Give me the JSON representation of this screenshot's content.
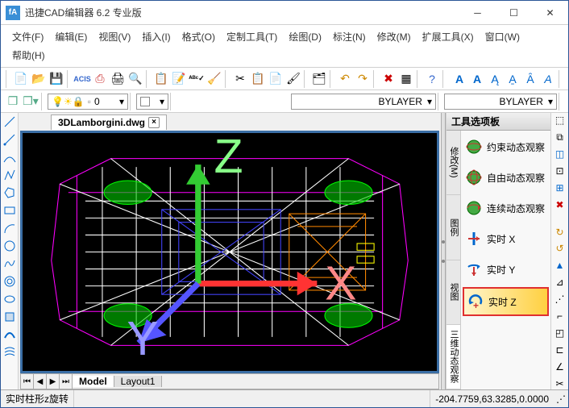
{
  "window": {
    "title": "迅捷CAD编辑器 6.2 专业版"
  },
  "menu": [
    "文件(F)",
    "编辑(E)",
    "视图(V)",
    "插入(I)",
    "格式(O)",
    "定制工具(T)",
    "绘图(D)",
    "标注(N)",
    "修改(M)",
    "扩展工具(X)",
    "窗口(W)",
    "帮助(H)"
  ],
  "document": {
    "tab": "3DLamborgini.dwg",
    "close": "×"
  },
  "layer_combo": "0",
  "bylayer1": "BYLAYER",
  "bylayer2": "BYLAYER",
  "layout": {
    "tabs": [
      "Model",
      "Layout1"
    ]
  },
  "palette": {
    "title": "工具选项板",
    "vtabs": [
      "修改(M)",
      "图例",
      "视图",
      "三维动态观察"
    ],
    "items": [
      {
        "label": "约束动态观察",
        "icon": "orbit-constrained"
      },
      {
        "label": "自由动态观察",
        "icon": "orbit-free"
      },
      {
        "label": "连续动态观察",
        "icon": "orbit-continuous"
      },
      {
        "label": "实时 X",
        "icon": "axis-x"
      },
      {
        "label": "实时 Y",
        "icon": "axis-y"
      },
      {
        "label": "实时 Z",
        "icon": "axis-z",
        "selected": true
      }
    ]
  },
  "status": {
    "left": "实时柱形z旋转",
    "right": "-204.7759,63.3285,0.0000"
  },
  "ucs": {
    "x": "X",
    "y": "Y",
    "z": "Z"
  }
}
